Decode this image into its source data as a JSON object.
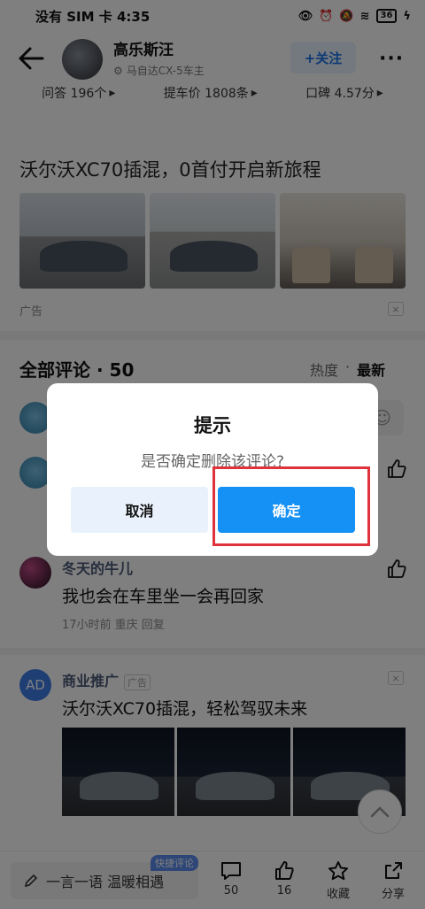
{
  "status_bar": {
    "carrier_time": "没有 SIM 卡 4:35",
    "battery": "36"
  },
  "header": {
    "author_name": "高乐斯汪",
    "author_tag": "马自达CX-5车主",
    "follow_label": "+关注"
  },
  "stats": [
    {
      "label": "问答 196个"
    },
    {
      "label": "提车价 1808条"
    },
    {
      "label": "口碑 4.57分"
    }
  ],
  "ad": {
    "title": "沃尔沃XC70插混，0首付开启新旅程",
    "label": "广告",
    "close": "×"
  },
  "comments": {
    "header": "全部评论 · 50",
    "sort_hot": "热度",
    "sort_sep": "·",
    "sort_new": "最新",
    "items": [
      {
        "name": "冬天的牛儿",
        "body": "我也会在车里坐一会再回家",
        "meta": "17小时前 重庆 回复"
      }
    ],
    "promo": {
      "avatar_text": "AD",
      "name": "商业推广",
      "badge": "广告",
      "body": "沃尔沃XC70插混，轻松驾驭未来"
    }
  },
  "bottom_bar": {
    "input_placeholder": "一言一语 温暖相遇",
    "quick_tag": "快捷评论",
    "comment_count": "50",
    "like_count": "16",
    "favorite_label": "收藏",
    "share_label": "分享"
  },
  "dialog": {
    "title": "提示",
    "message": "是否确定删除该评论?",
    "cancel_label": "取消",
    "confirm_label": "确定"
  },
  "colors": {
    "confirm_bg": "#1590f5",
    "cancel_bg": "#e9f2fc",
    "highlight": "#e0323a"
  }
}
